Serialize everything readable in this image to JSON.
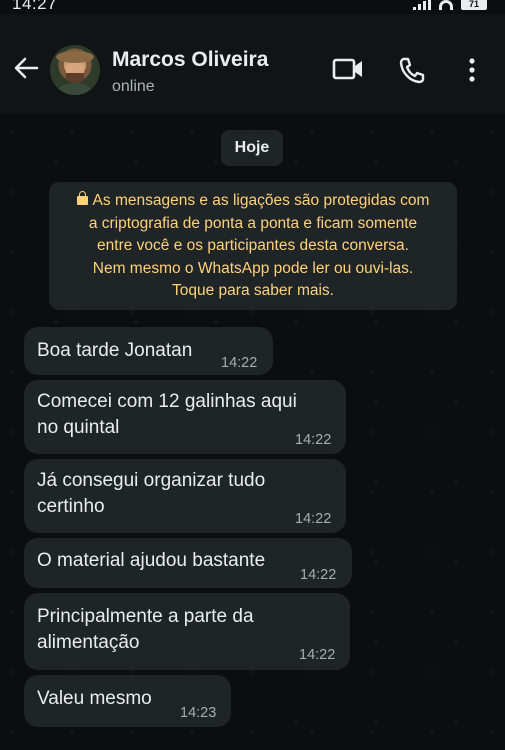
{
  "status_bar": {
    "time": "14:27",
    "battery": "71"
  },
  "header": {
    "contact_name": "Marcos Oliveira",
    "contact_status": "online",
    "icons": [
      "back-arrow-icon",
      "video-call-icon",
      "voice-call-icon",
      "more-vertical-icon"
    ]
  },
  "chat": {
    "date_label": "Hoje",
    "encryption_notice": [
      "As mensagens e as ligações são protegidas com",
      "a criptografia de ponta a ponta e ficam somente",
      "entre você e os participantes desta conversa.",
      "Nem mesmo o WhatsApp pode ler ou ouvi-las.",
      "Toque para saber mais."
    ],
    "messages": [
      {
        "lines": [
          "Boa tarde Jonatan"
        ],
        "time": "14:22"
      },
      {
        "lines": [
          "Comecei com 12 galinhas aqui",
          "no quintal"
        ],
        "time": "14:22"
      },
      {
        "lines": [
          "Já consegui organizar tudo",
          "certinho"
        ],
        "time": "14:22"
      },
      {
        "lines": [
          "O material ajudou bastante"
        ],
        "time": "14:22"
      },
      {
        "lines": [
          "Principalmente a parte da",
          "alimentação"
        ],
        "time": "14:22"
      },
      {
        "lines": [
          "Valeu mesmo"
        ],
        "time": "14:23"
      }
    ]
  },
  "colors": {
    "background": "#0b0d0f",
    "header": "#111416",
    "bubble": "#1f2426",
    "encryption_text": "#ffd279",
    "time_text": "#a6adb2"
  }
}
